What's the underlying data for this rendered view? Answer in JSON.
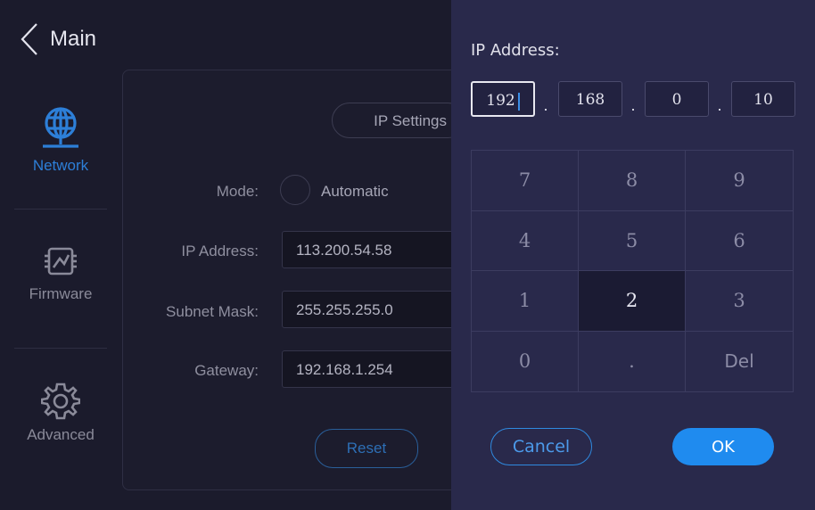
{
  "header": {
    "back_label": "Main"
  },
  "sidebar": {
    "items": [
      {
        "label": "Network",
        "icon": "globe-network-icon",
        "active": true
      },
      {
        "label": "Firmware",
        "icon": "chip-icon",
        "active": false
      },
      {
        "label": "Advanced",
        "icon": "gear-icon",
        "active": false
      }
    ]
  },
  "settings": {
    "tab_label": "IP Settings",
    "mode_label": "Mode:",
    "mode_value": "Automatic",
    "ip_label": "IP Address:",
    "ip_value": "113.200.54.58",
    "subnet_label": "Subnet Mask:",
    "subnet_value": "255.255.255.0",
    "gateway_label": "Gateway:",
    "gateway_value": "192.168.1.254",
    "reset_label": "Reset"
  },
  "keypad_dialog": {
    "title": "IP Address:",
    "octets": [
      "192",
      "168",
      "0",
      "10"
    ],
    "separator": ".",
    "keys": [
      "7",
      "8",
      "9",
      "4",
      "5",
      "6",
      "1",
      "2",
      "3",
      "0",
      ".",
      "Del"
    ],
    "cancel_label": "Cancel",
    "ok_label": "OK"
  },
  "colors": {
    "accent": "#1f8bef",
    "active_nav": "#2d7fd8",
    "overlay_bg": "#29294b",
    "page_bg": "#1b1b2c"
  }
}
